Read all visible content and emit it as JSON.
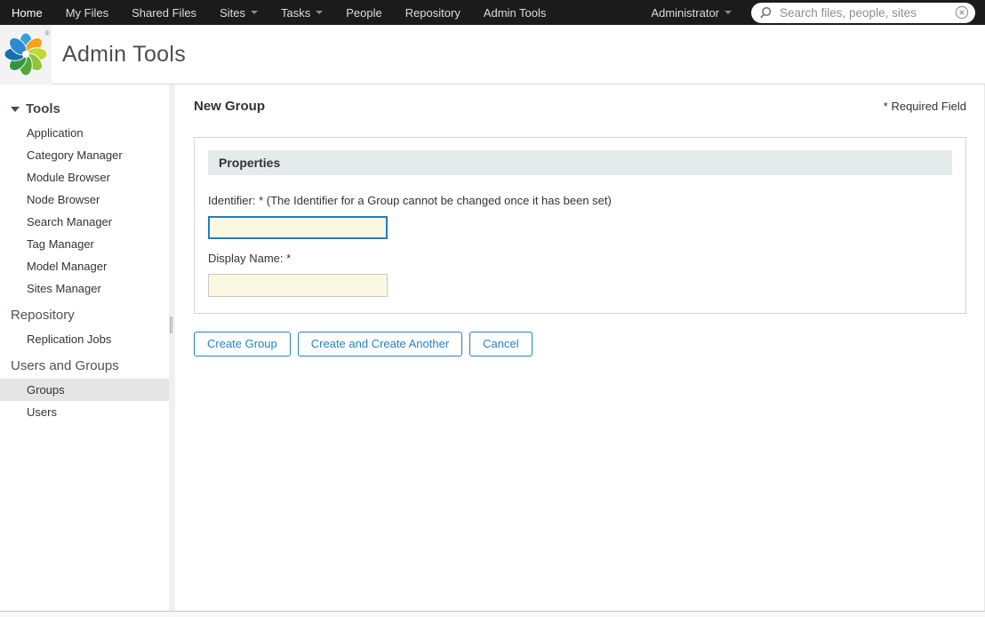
{
  "nav": {
    "items": [
      {
        "label": "Home",
        "dropdown": false
      },
      {
        "label": "My Files",
        "dropdown": false
      },
      {
        "label": "Shared Files",
        "dropdown": false
      },
      {
        "label": "Sites",
        "dropdown": true
      },
      {
        "label": "Tasks",
        "dropdown": true
      },
      {
        "label": "People",
        "dropdown": false
      },
      {
        "label": "Repository",
        "dropdown": false
      },
      {
        "label": "Admin Tools",
        "dropdown": false
      }
    ],
    "user_menu": {
      "label": "Administrator"
    },
    "search": {
      "placeholder": "Search files, people, sites",
      "value": ""
    }
  },
  "header": {
    "app_title": "Admin Tools",
    "logo": "alfresco-flower-logo",
    "registered_mark": "®"
  },
  "sidebar": {
    "groups": [
      {
        "label": "Tools",
        "collapsed": false,
        "items": [
          {
            "label": "Application"
          },
          {
            "label": "Category Manager"
          },
          {
            "label": "Module Browser"
          },
          {
            "label": "Node Browser"
          },
          {
            "label": "Search Manager"
          },
          {
            "label": "Tag Manager"
          },
          {
            "label": "Model Manager"
          },
          {
            "label": "Sites Manager"
          }
        ]
      },
      {
        "label": "Repository",
        "items": [
          {
            "label": "Replication Jobs"
          }
        ]
      },
      {
        "label": "Users and Groups",
        "items": [
          {
            "label": "Groups",
            "selected": true
          },
          {
            "label": "Users",
            "selected": false
          }
        ]
      }
    ]
  },
  "main": {
    "title": "New Group",
    "required_note": "* Required Field",
    "panel": {
      "header": "Properties",
      "fields": [
        {
          "label": "Identifier: * (The Identifier for a Group cannot be changed once it has been set)",
          "value": "",
          "focused": true
        },
        {
          "label": "Display Name: *",
          "value": "",
          "focused": false
        }
      ]
    },
    "buttons": [
      {
        "label": "Create Group"
      },
      {
        "label": "Create and Create Another"
      },
      {
        "label": "Cancel"
      }
    ]
  },
  "colors": {
    "topnav_bg": "#1b1b1b",
    "accent_blue": "#2383c4",
    "input_fill": "#fbf8e2",
    "focus_border": "#1f7fc0",
    "panel_bar_bg": "#e5eaeb",
    "selected_item_bg": "#e5e5e5"
  }
}
